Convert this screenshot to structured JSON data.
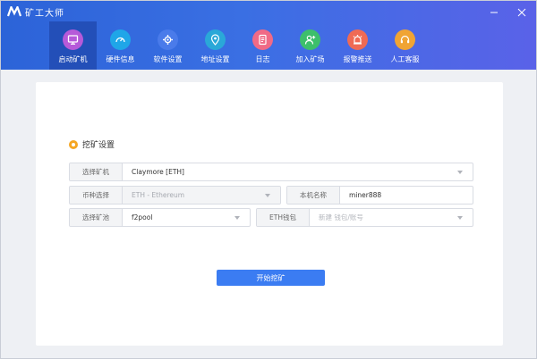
{
  "app": {
    "title": "矿工大师",
    "logo_icon": "m-logo-icon"
  },
  "window_controls": {
    "minimize_icon": "minimize-icon",
    "close_icon": "close-icon"
  },
  "nav": {
    "active_index": 0,
    "items": [
      {
        "label": "启动矿机",
        "icon": "monitor-icon",
        "color": "#b65ad9"
      },
      {
        "label": "硬件信息",
        "icon": "gauge-icon",
        "color": "#1fa6e8"
      },
      {
        "label": "软件设置",
        "icon": "gear-icon",
        "color": "#4a7bea"
      },
      {
        "label": "地址设置",
        "icon": "location-icon",
        "color": "#2aa8d8"
      },
      {
        "label": "日志",
        "icon": "document-icon",
        "color": "#f06a86"
      },
      {
        "label": "加入矿场",
        "icon": "add-user-icon",
        "color": "#3dbf6b"
      },
      {
        "label": "报警推送",
        "icon": "alarm-icon",
        "color": "#ef6a55"
      },
      {
        "label": "人工客服",
        "icon": "headset-icon",
        "color": "#f0a434"
      }
    ]
  },
  "settings": {
    "section_title": "挖矿设置",
    "miner": {
      "label": "选择矿机",
      "value": "Claymore [ETH]"
    },
    "coin": {
      "label": "币种选择",
      "value": "ETH - Ethereum"
    },
    "machine_name": {
      "label": "本机名称",
      "value": "miner888"
    },
    "pool": {
      "label": "选择矿池",
      "value": "f2pool"
    },
    "wallet": {
      "label": "ETH钱包",
      "placeholder": "新建 钱包/账号"
    }
  },
  "actions": {
    "start_label": "开始挖矿"
  },
  "colors": {
    "topbar_start": "#2c63d8",
    "topbar_end": "#5a62e8",
    "active_nav": "#234fb8",
    "primary_button": "#3b7cf2",
    "section_dot": "#f5a623"
  }
}
